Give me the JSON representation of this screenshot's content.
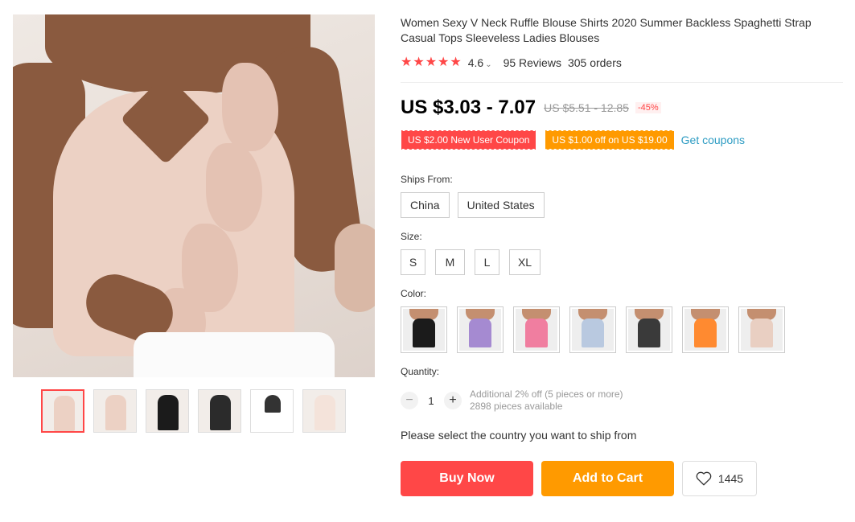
{
  "product": {
    "title": "Women Sexy V Neck Ruffle Blouse Shirts 2020 Summer Backless Spaghetti Strap Casual Tops Sleeveless Ladies Blouses",
    "rating": "4.6",
    "reviews": "95 Reviews",
    "orders": "305 orders",
    "price": "US $3.03 - 7.07",
    "old_price": "US $5.51 - 12.85",
    "discount": "-45%"
  },
  "coupons": {
    "new_user": "US $2.00 New User Coupon",
    "store": "US $1.00 off on US $19.00",
    "get_link": "Get coupons"
  },
  "ships_from": {
    "label": "Ships From:",
    "options": [
      "China",
      "United States"
    ]
  },
  "size": {
    "label": "Size:",
    "options": [
      "S",
      "M",
      "L",
      "XL"
    ]
  },
  "color": {
    "label": "Color:",
    "swatches": [
      "#1b1b1b",
      "#a58ad1",
      "#f07ea0",
      "#b9c9e0",
      "#3a3a3a",
      "#ff8a30",
      "#e9cfc2"
    ]
  },
  "quantity": {
    "label": "Quantity:",
    "value": "1",
    "minus": "−",
    "plus": "+",
    "promo": "Additional 2% off (5 pieces or more)",
    "available": "2898 pieces available"
  },
  "ship_note": "Please select the country you want to ship from",
  "actions": {
    "buy": "Buy Now",
    "cart": "Add to Cart",
    "wishlist_count": "1445"
  },
  "theme": {
    "accent_red": "#ff4747",
    "accent_orange": "#ff9a00",
    "link_blue": "#2e9cc3"
  }
}
